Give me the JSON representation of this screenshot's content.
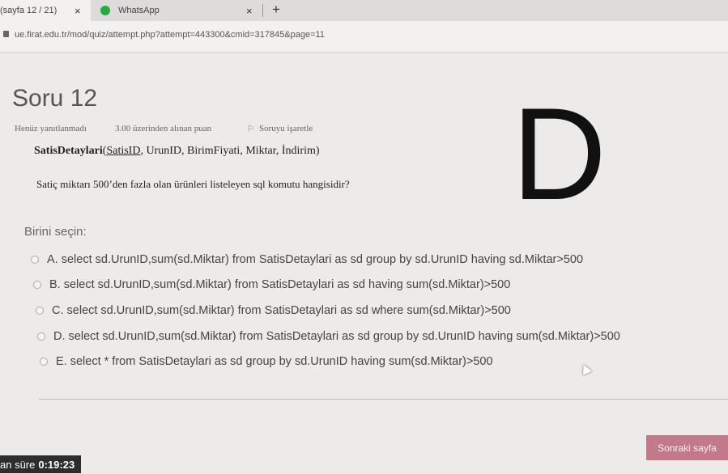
{
  "browser": {
    "tabs": [
      {
        "label": "(sayfa 12 / 21)",
        "close": "×"
      },
      {
        "label": "WhatsApp",
        "close": "×"
      }
    ],
    "new_tab": "+",
    "url": "ue.firat.edu.tr/mod/quiz/attempt.php?attempt=443300&cmid=317845&page=11"
  },
  "question": {
    "title": "Soru 12",
    "status": "Henüz yanıtlanmadı",
    "points": "3.00 üzerinden alınan puan",
    "flag_label": "Soruyu işaretle",
    "schema": {
      "table": "SatisDetaylari",
      "open": "(",
      "pk": "SatisID",
      "rest": ", UrunID, BirimFiyati, Miktar, İndirim)"
    },
    "text": "Satiç miktarı 500’den fazla olan ürünleri listeleyen sql komutu hangisidir?",
    "handwritten_answer": "D",
    "prompt": "Birini seçin:",
    "options": [
      "A. select sd.UrunID,sum(sd.Miktar) from SatisDetaylari as sd group by sd.UrunID having sd.Miktar>500",
      "B. select sd.UrunID,sum(sd.Miktar) from SatisDetaylari as sd having sum(sd.Miktar)>500",
      "C. select sd.UrunID,sum(sd.Miktar) from SatisDetaylari as sd where sum(sd.Miktar)>500",
      "D. select sd.UrunID,sum(sd.Miktar) from SatisDetaylari as sd group by sd.UrunID having sum(sd.Miktar)>500",
      "E. select * from SatisDetaylari as sd group by sd.UrunID having sum(sd.Miktar)>500"
    ]
  },
  "footer": {
    "next_label": "Sonraki sayfa",
    "timer_label": "an süre",
    "timer_value": "0:19:23"
  },
  "colors": {
    "next_button": "#c27a8a",
    "whatsapp": "#2aa845"
  },
  "icons": [
    "lock-icon",
    "whatsapp-icon",
    "close-icon",
    "flag-icon",
    "radio-icon",
    "cursor-icon"
  ]
}
